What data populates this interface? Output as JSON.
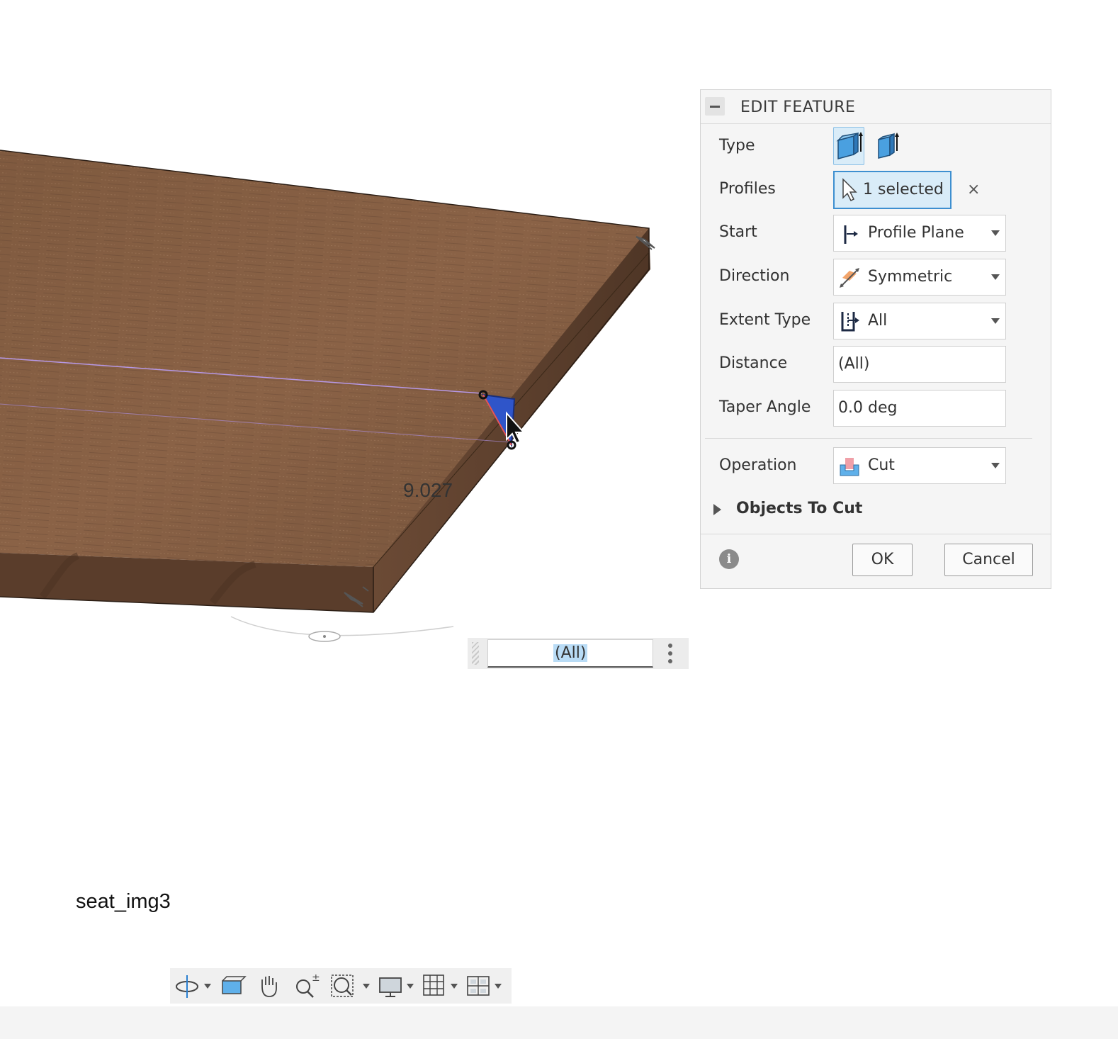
{
  "panel": {
    "title": "EDIT FEATURE",
    "rows": {
      "type": "Type",
      "profiles": "Profiles",
      "start": "Start",
      "direction": "Direction",
      "extent_type": "Extent Type",
      "distance": "Distance",
      "taper_angle": "Taper Angle",
      "operation": "Operation"
    },
    "profiles_value": "1 selected",
    "start_value": "Profile Plane",
    "direction_value": "Symmetric",
    "extent_type_value": "All",
    "distance_value": "(All)",
    "taper_angle_value": "0.0 deg",
    "operation_value": "Cut",
    "objects_to_cut": "Objects To Cut",
    "ok": "OK",
    "cancel": "Cancel",
    "clear_symbol": "×",
    "info_symbol": "i"
  },
  "canvas": {
    "dimension_label": "9.027",
    "inline_input_value": "(All)",
    "caption": "seat_img3"
  },
  "navbar": {
    "items": [
      "orbit-icon",
      "look-at-icon",
      "pan-icon",
      "zoom-icon",
      "fit-icon",
      "display-settings-icon",
      "grid-icon",
      "viewports-icon"
    ]
  },
  "colors": {
    "wood_top": "#7e5a3f",
    "wood_side": "#5d4030",
    "selection_blue": "#d9ecf8",
    "selection_border": "#3d8fd0",
    "sketch_line": "#a98bd6"
  }
}
